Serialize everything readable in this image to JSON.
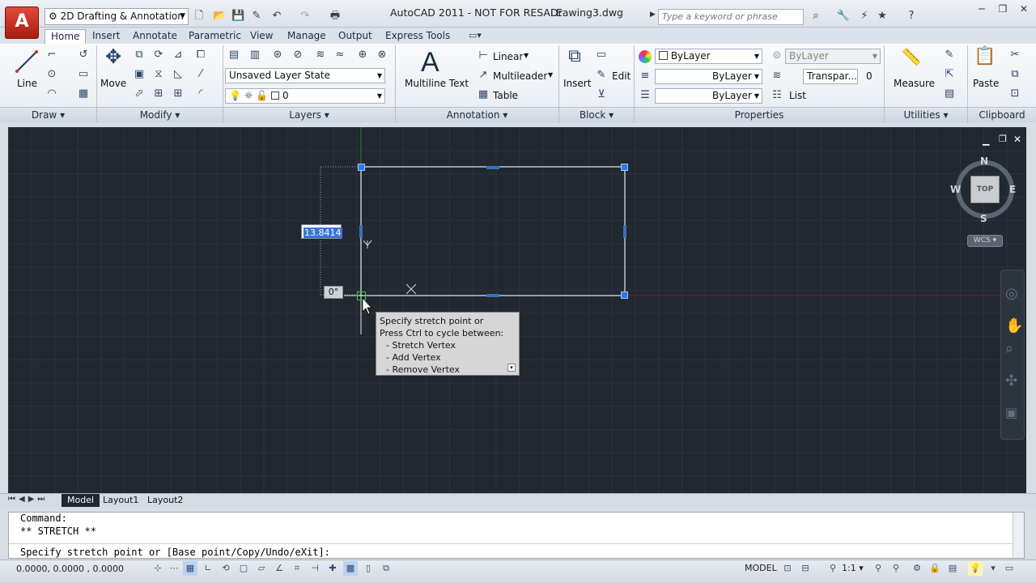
{
  "titlebar": {
    "workspace": "2D Drafting & Annotation",
    "title": "AutoCAD 2011 - NOT FOR RESALE",
    "document": "Drawing3.dwg",
    "search_placeholder": "Type a keyword or phrase"
  },
  "ribbon_tabs": [
    "Home",
    "Insert",
    "Annotate",
    "Parametric",
    "View",
    "Manage",
    "Output",
    "Express Tools"
  ],
  "ribbon": {
    "draw": {
      "line": "Line",
      "footer": "Draw"
    },
    "modify": {
      "move": "Move",
      "footer": "Modify"
    },
    "layers": {
      "layer_state": "Unsaved Layer State",
      "layer_name": "0",
      "footer": "Layers"
    },
    "annotation": {
      "multiline_text": "Multiline Text",
      "linear": "Linear",
      "multileader": "Multileader",
      "table": "Table",
      "footer": "Annotation"
    },
    "block": {
      "insert": "Insert",
      "edit": "Edit",
      "footer": "Block"
    },
    "properties": {
      "color": "ByLayer",
      "linetype": "ByLayer",
      "lineweight": "ByLayer",
      "plotstyle": "ByLayer",
      "transparency": "Transpar...",
      "transparency_value": "0",
      "list": "List",
      "footer": "Properties"
    },
    "utilities": {
      "measure": "Measure",
      "footer": "Utilities"
    },
    "clipboard": {
      "paste": "Paste",
      "footer": "Clipboard"
    }
  },
  "viewcube": {
    "north": "N",
    "south": "S",
    "east": "E",
    "west": "W",
    "face": "TOP",
    "ucs": "WCS"
  },
  "dynamic_input": {
    "distance": "13.8414",
    "angle": "0°"
  },
  "tooltip": {
    "line1": "Specify stretch point or",
    "line2": "Press Ctrl to cycle between:",
    "line3": "- Stretch Vertex",
    "line4": "- Add Vertex",
    "line5": "- Remove Vertex"
  },
  "layout_tabs": [
    "Model",
    "Layout1",
    "Layout2"
  ],
  "command": {
    "line1": "Command:",
    "line2": "** STRETCH **",
    "prompt": "Specify stretch point or [Base point/Copy/Undo/eXit]:"
  },
  "status": {
    "coords": "0.0000, 0.0000 , 0.0000",
    "space": "MODEL",
    "scale": "1:1"
  },
  "colors": {
    "canvas": "#212830",
    "grip": "#2c7be5",
    "accent": "#3b6fb8"
  }
}
